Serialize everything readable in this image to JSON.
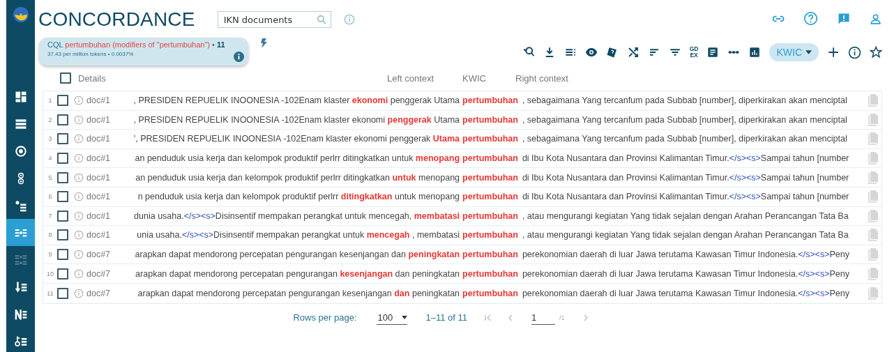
{
  "sidebar": {
    "items": [
      {
        "selected": false,
        "disabled": false
      },
      {
        "selected": false,
        "disabled": false
      },
      {
        "selected": false,
        "disabled": false
      },
      {
        "selected": false,
        "disabled": false
      },
      {
        "selected": false,
        "disabled": false
      },
      {
        "selected": true,
        "disabled": false
      },
      {
        "selected": false,
        "disabled": true
      },
      {
        "selected": false,
        "disabled": false
      },
      {
        "selected": false,
        "disabled": false
      },
      {
        "selected": false,
        "disabled": false
      }
    ]
  },
  "header": {
    "title": "CONCORDANCE",
    "corpus_search": {
      "value": "IKN documents"
    }
  },
  "query": {
    "label": "CQL",
    "query": "pertumbuhan (modifiers of \"pertumbuhan\")",
    "separator": "•",
    "count": "11",
    "stats": "37.43 per million tokens • 0.0037%"
  },
  "toolbar": {
    "gdex_label": [
      "GD",
      "EX"
    ],
    "view_mode": "KWIC"
  },
  "table": {
    "columns": {
      "details": "Details",
      "details_checked": false,
      "left": "Left context",
      "kwic": "KWIC",
      "right": "Right context"
    },
    "rows": [
      {
        "number": "1",
        "checked": false,
        "doc": "doc#1",
        "left": [
          {
            "kind": "plain",
            "text": ", PRESIDEN REPUELIK INOONESIA -102Enam klaster "
          },
          {
            "kind": "collocate",
            "text": "ekonomi"
          },
          {
            "kind": "plain",
            "text": " penggerak Utama"
          }
        ],
        "kwic": "pertumbuhan",
        "right": [
          {
            "kind": "plain",
            "text": ", sebagaimana Yang tercanfum pada Subbab [number], diperkirakan akan menciptal"
          }
        ]
      },
      {
        "number": "2",
        "checked": false,
        "doc": "doc#1",
        "left": [
          {
            "kind": "plain",
            "text": ", PRESIDEN REPUELIK INOONESIA -102Enam klaster ekonomi "
          },
          {
            "kind": "collocate",
            "text": "penggerak"
          },
          {
            "kind": "plain",
            "text": " Utama"
          }
        ],
        "kwic": "pertumbuhan",
        "right": [
          {
            "kind": "plain",
            "text": ", sebagaimana Yang tercanfum pada Subbab [number], diperkirakan akan menciptal"
          }
        ]
      },
      {
        "number": "3",
        "checked": false,
        "doc": "doc#1",
        "left": [
          {
            "kind": "plain",
            "text": "', PRESIDEN REPUELIK INOONESIA -102Enam klaster ekonomi penggerak "
          },
          {
            "kind": "collocate",
            "text": "Utama"
          }
        ],
        "kwic": "pertumbuhan",
        "right": [
          {
            "kind": "plain",
            "text": ", sebagaimana Yang tercanfum pada Subbab [number], diperkirakan akan menciptal"
          }
        ]
      },
      {
        "number": "4",
        "checked": false,
        "doc": "doc#1",
        "left": [
          {
            "kind": "plain",
            "text": "an penduduk usia kerja dan kelompok produktif perlrr ditingkatkan untuk "
          },
          {
            "kind": "collocate",
            "text": "menopang"
          }
        ],
        "kwic": "pertumbuhan",
        "right": [
          {
            "kind": "plain",
            "text": "di Ibu Kota Nusantara dan Provinsi Kalimantan Timur."
          },
          {
            "kind": "tag",
            "text": "</s><s>"
          },
          {
            "kind": "plain",
            "text": "Sampai tahun [number"
          }
        ]
      },
      {
        "number": "5",
        "checked": false,
        "doc": "doc#1",
        "left": [
          {
            "kind": "plain",
            "text": "an penduduk usia kerja dan kelompok produktif perlrr ditingkatkan "
          },
          {
            "kind": "collocate",
            "text": "untuk"
          },
          {
            "kind": "plain",
            "text": " menopang"
          }
        ],
        "kwic": "pertumbuhan",
        "right": [
          {
            "kind": "plain",
            "text": "di Ibu Kota Nusantara dan Provinsi Kalimantan Timur."
          },
          {
            "kind": "tag",
            "text": "</s><s>"
          },
          {
            "kind": "plain",
            "text": "Sampai tahun [number"
          }
        ]
      },
      {
        "number": "6",
        "checked": false,
        "doc": "doc#1",
        "left": [
          {
            "kind": "plain",
            "text": "n penduduk usia kerja dan kelompok produktif perlrr "
          },
          {
            "kind": "collocate",
            "text": "ditingkatkan"
          },
          {
            "kind": "plain",
            "text": " untuk menopang"
          }
        ],
        "kwic": "pertumbuhan",
        "right": [
          {
            "kind": "plain",
            "text": "di Ibu Kota Nusantara dan Provinsi Kalimantan Timur."
          },
          {
            "kind": "tag",
            "text": "</s><s>"
          },
          {
            "kind": "plain",
            "text": "Sampai tahun [number"
          }
        ]
      },
      {
        "number": "7",
        "checked": false,
        "doc": "doc#1",
        "left": [
          {
            "kind": "plain",
            "text": "dunia usaha."
          },
          {
            "kind": "tag",
            "text": "</s><s>"
          },
          {
            "kind": "plain",
            "text": "Disinsentif mempakan perangkat untuk mencegah, "
          },
          {
            "kind": "collocate",
            "text": "membatasi"
          }
        ],
        "kwic": "pertumbuhan",
        "right": [
          {
            "kind": "plain",
            "text": ", atau mengurangi kegiatan Yang tidak sejalan dengan Arahan Perancangan Tata Ba"
          }
        ]
      },
      {
        "number": "8",
        "checked": false,
        "doc": "doc#1",
        "left": [
          {
            "kind": "plain",
            "text": "unia usaha."
          },
          {
            "kind": "tag",
            "text": "</s><s>"
          },
          {
            "kind": "plain",
            "text": "Disinsentif mempakan perangkat untuk "
          },
          {
            "kind": "collocate",
            "text": "mencegah"
          },
          {
            "kind": "plain",
            "text": " , membatasi"
          }
        ],
        "kwic": "pertumbuhan",
        "right": [
          {
            "kind": "plain",
            "text": ", atau mengurangi kegiatan Yang tidak sejalan dengan Arahan Perancangan Tata Ba"
          }
        ]
      },
      {
        "number": "9",
        "checked": false,
        "doc": "doc#7",
        "left": [
          {
            "kind": "plain",
            "text": "arapkan dapat mendorong percepatan pengurangan kesenjangan dan "
          },
          {
            "kind": "collocate",
            "text": "peningkatan"
          }
        ],
        "kwic": "pertumbuhan",
        "right": [
          {
            "kind": "plain",
            "text": "perekonomian daerah di luar Jawa terutama Kawasan Timur Indonesia."
          },
          {
            "kind": "tag",
            "text": "</s><s>"
          },
          {
            "kind": "plain",
            "text": "Peny"
          }
        ]
      },
      {
        "number": "10",
        "checked": false,
        "doc": "doc#7",
        "left": [
          {
            "kind": "plain",
            "text": "arapkan dapat mendorong percepatan pengurangan "
          },
          {
            "kind": "collocate",
            "text": "kesenjangan"
          },
          {
            "kind": "plain",
            "text": " dan peningkatan"
          }
        ],
        "kwic": "pertumbuhan",
        "right": [
          {
            "kind": "plain",
            "text": "perekonomian daerah di luar Jawa terutama Kawasan Timur Indonesia."
          },
          {
            "kind": "tag",
            "text": "</s><s>"
          },
          {
            "kind": "plain",
            "text": "Peny"
          }
        ]
      },
      {
        "number": "11",
        "checked": false,
        "doc": "doc#7",
        "left": [
          {
            "kind": "plain",
            "text": "arapkan dapat mendorong percepatan pengurangan kesenjangan "
          },
          {
            "kind": "collocate",
            "text": "dan"
          },
          {
            "kind": "plain",
            "text": " peningkatan"
          }
        ],
        "kwic": "pertumbuhan",
        "right": [
          {
            "kind": "plain",
            "text": "perekonomian daerah di luar Jawa terutama Kawasan Timur Indonesia."
          },
          {
            "kind": "tag",
            "text": "</s><s>"
          },
          {
            "kind": "plain",
            "text": "Peny"
          }
        ]
      }
    ]
  },
  "pagination": {
    "rows_per_page_label": "Rows per page:",
    "rows_per_page": "100",
    "range": "1–11 of 11",
    "page": "1",
    "page_total": "/1"
  }
}
